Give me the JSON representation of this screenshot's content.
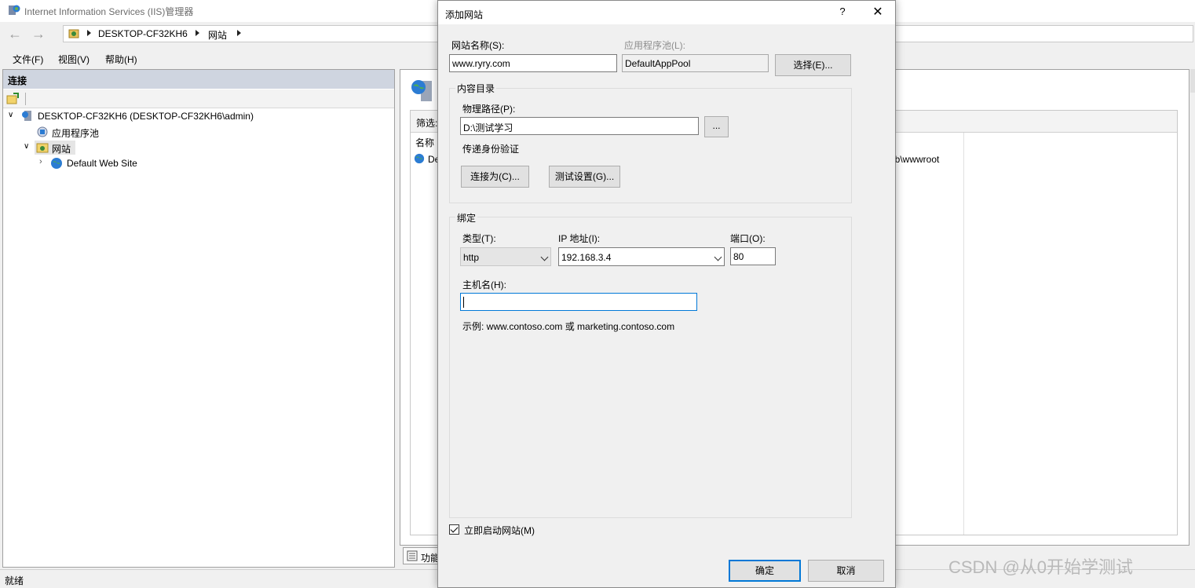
{
  "window": {
    "title": "Internet Information Services (IIS)管理器"
  },
  "address_bar": {
    "segments": [
      "DESKTOP-CF32KH6",
      "网站"
    ]
  },
  "menu": [
    {
      "label": "文件(F)"
    },
    {
      "label": "视图(V)"
    },
    {
      "label": "帮助(H)"
    }
  ],
  "connections": {
    "header": "连接",
    "tree": [
      {
        "label": "DESKTOP-CF32KH6 (DESKTOP-CF32KH6\\admin)"
      },
      {
        "label": "应用程序池"
      },
      {
        "label": "网站"
      },
      {
        "label": "Default Web Site"
      }
    ]
  },
  "content": {
    "filter_label": "筛选:",
    "name_col": "名称",
    "row_site": "De",
    "row_path": "ub\\wwwroot",
    "bottom_tab": "功能"
  },
  "status": {
    "text": "就绪"
  },
  "dialog": {
    "title": "添加网站",
    "help": "?",
    "site_name_label": "网站名称(S):",
    "site_name_value": "www.ryry.com",
    "app_pool_label": "应用程序池(L):",
    "app_pool_value": "DefaultAppPool",
    "select_button": "选择(E)...",
    "content_group": "内容目录",
    "physical_path_label": "物理路径(P):",
    "physical_path_value": "D:\\测试学习",
    "browse_button": "...",
    "pass_auth_label": "传递身份验证",
    "connect_as_button": "连接为(C)...",
    "test_settings_button": "测试设置(G)...",
    "binding_group": "绑定",
    "type_label": "类型(T):",
    "type_value": "http",
    "ip_label": "IP 地址(I):",
    "ip_value": "192.168.3.4",
    "port_label": "端口(O):",
    "port_value": "80",
    "hostname_label": "主机名(H):",
    "hostname_value": "",
    "example_text": "示例: www.contoso.com 或 marketing.contoso.com",
    "start_now_label": "立即启动网站(M)",
    "start_now_checked": true,
    "ok_button": "确定",
    "cancel_button": "取消"
  },
  "watermark": "CSDN @从0开始学测试"
}
